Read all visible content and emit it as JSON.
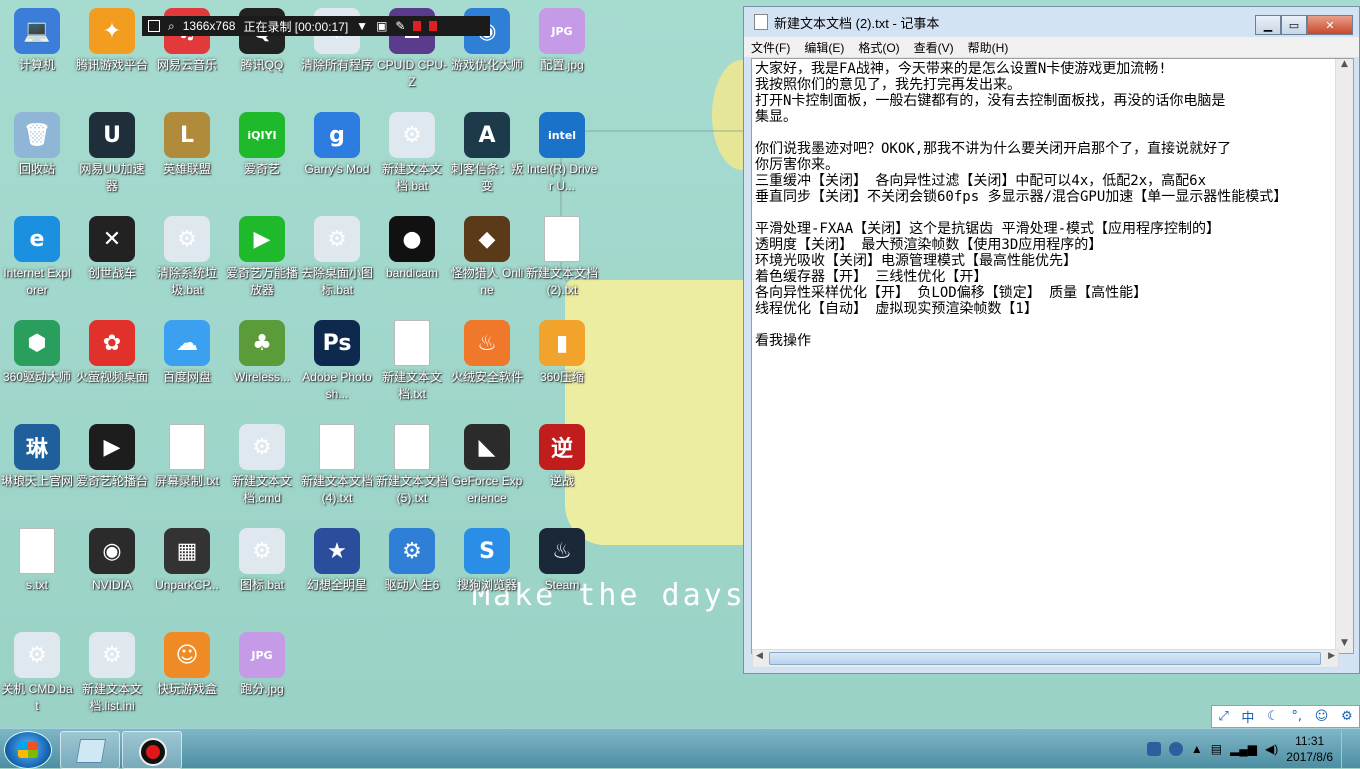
{
  "recorder": {
    "resolution": "1366x768",
    "status": "正在录制 [00:00:17]"
  },
  "notepad": {
    "title": "新建文本文档 (2).txt - 记事本",
    "menu": [
      "文件(F)",
      "编辑(E)",
      "格式(O)",
      "查看(V)",
      "帮助(H)"
    ],
    "content": "大家好，我是FA战神，今天带来的是怎么设置N卡使游戏更加流畅!\n我按照你们的意见了，我先打完再发出来。\n打开N卡控制面板，一般右键都有的，没有去控制面板找，再没的话你电脑是\n集显。\n\n你们说我墨迹对吧？OKOK,那我不讲为什么要关闭开启那个了，直接说就好了\n你厉害你来。\n三重缓冲【关闭】 各向异性过滤【关闭】中配可以4x，低配2x，高配6x\n垂直同步【关闭】不关闭会锁60fps 多显示器/混合GPU加速【单一显示器性能模式】\n\n平滑处理-FXAA【关闭】这个是抗锯齿 平滑处理-模式【应用程序控制的】\n透明度【关闭】 最大预渲染帧数【使用3D应用程序的】\n环境光吸收【关闭】电源管理模式【最高性能优先】\n着色缓存器【开】 三线性优化【开】\n各向异性采样优化【开】 负LOD偏移【锁定】 质量【高性能】\n线程优化【自动】 虚拟现实预渲染帧数【1】\n\n看我操作"
  },
  "wallpaper_text": "Make the days",
  "desktop_icons": [
    {
      "label": "计算机",
      "glyph": "💻",
      "color": "#3b7dd8"
    },
    {
      "label": "腾讯游戏平台",
      "glyph": "✦",
      "color": "#f29d1f"
    },
    {
      "label": "网易云音乐",
      "glyph": "♫",
      "color": "#e23a3a"
    },
    {
      "label": "腾讯QQ",
      "glyph": "Q",
      "color": "#222222"
    },
    {
      "label": "清除所有程序",
      "glyph": "⚙",
      "color": "#dfe7ef"
    },
    {
      "label": "CPUID CPU-Z",
      "glyph": "Z",
      "color": "#5a3b8c"
    },
    {
      "label": "游戏优化大师",
      "glyph": "◉",
      "color": "#2f7fd6"
    },
    {
      "label": "配置.jpg",
      "glyph": "JPG",
      "color": "#c59be8"
    },
    {
      "label": "回收站",
      "glyph": "🗑",
      "color": "#8fb6d6"
    },
    {
      "label": "网易UU加速器",
      "glyph": "U",
      "color": "#1e2f3b"
    },
    {
      "label": "英雄联盟",
      "glyph": "L",
      "color": "#b08b3c"
    },
    {
      "label": "爱奇艺",
      "glyph": "iQIYI",
      "color": "#1fb92c"
    },
    {
      "label": "Garry's Mod",
      "glyph": "g",
      "color": "#2d7de0"
    },
    {
      "label": "新建文本文档.bat",
      "glyph": "⚙",
      "color": "#dfe7ef"
    },
    {
      "label": "刺客信条：叛变",
      "glyph": "A",
      "color": "#1c3a4a"
    },
    {
      "label": "Intel(R) Driver U...",
      "glyph": "intel",
      "color": "#1a73c8"
    },
    {
      "label": "Internet Explorer",
      "glyph": "e",
      "color": "#1b8fe0"
    },
    {
      "label": "创世战车",
      "glyph": "✕",
      "color": "#222222"
    },
    {
      "label": "清除系统垃圾.bat",
      "glyph": "⚙",
      "color": "#dfe7ef"
    },
    {
      "label": "爱奇艺万能播放器",
      "glyph": "▶",
      "color": "#1fb92c"
    },
    {
      "label": "去除桌面小图标.bat",
      "glyph": "⚙",
      "color": "#dfe7ef"
    },
    {
      "label": "bandicam",
      "glyph": "●",
      "color": "#111111"
    },
    {
      "label": "怪物猎人 Online",
      "glyph": "◆",
      "color": "#5a3a18"
    },
    {
      "label": "新建文本文档 (2).txt",
      "glyph": "",
      "color": "#ffffff"
    },
    {
      "label": "360驱动大师",
      "glyph": "⬢",
      "color": "#2a9e5c"
    },
    {
      "label": "火萤视频桌面",
      "glyph": "✿",
      "color": "#e2302b"
    },
    {
      "label": "百度网盘",
      "glyph": "☁",
      "color": "#3aa0ef"
    },
    {
      "label": "Wireless...",
      "glyph": "♣",
      "color": "#5c9b3a"
    },
    {
      "label": "Adobe Photosh...",
      "glyph": "Ps",
      "color": "#0d2a4e"
    },
    {
      "label": "新建文本文档.txt",
      "glyph": "",
      "color": "#ffffff"
    },
    {
      "label": "火绒安全软件",
      "glyph": "♨",
      "color": "#f0782a"
    },
    {
      "label": "360压缩",
      "glyph": "▮",
      "color": "#f2a32c"
    },
    {
      "label": "琳琅天上官网",
      "glyph": "琳",
      "color": "#1f5f9c"
    },
    {
      "label": "爱奇艺轮播台",
      "glyph": "▶",
      "color": "#1d1d1d"
    },
    {
      "label": "屏幕录制.txt",
      "glyph": "",
      "color": "#ffffff"
    },
    {
      "label": "新建文本文档.cmd",
      "glyph": "⚙",
      "color": "#dfe7ef"
    },
    {
      "label": "新建文本文档 (4).txt",
      "glyph": "",
      "color": "#ffffff"
    },
    {
      "label": "新建文本文档 (5).txt",
      "glyph": "",
      "color": "#ffffff"
    },
    {
      "label": "GeForce Experience",
      "glyph": "◣",
      "color": "#2b2b2b"
    },
    {
      "label": "逆战",
      "glyph": "逆",
      "color": "#c21d1d"
    },
    {
      "label": "s.txt",
      "glyph": "",
      "color": "#ffffff"
    },
    {
      "label": "NVIDIA",
      "glyph": "◉",
      "color": "#2b2b2b"
    },
    {
      "label": "UnparkCP...",
      "glyph": "▦",
      "color": "#333333"
    },
    {
      "label": "图标.bat",
      "glyph": "⚙",
      "color": "#dfe7ef"
    },
    {
      "label": "幻想全明星",
      "glyph": "★",
      "color": "#2b4e9c"
    },
    {
      "label": "驱动人生6",
      "glyph": "⚙",
      "color": "#2f7fd6"
    },
    {
      "label": "搜狗浏览器",
      "glyph": "S",
      "color": "#2a8ee6"
    },
    {
      "label": "Steam",
      "glyph": "♨",
      "color": "#1b2838"
    },
    {
      "label": "关机 CMD.bat",
      "glyph": "⚙",
      "color": "#dfe7ef"
    },
    {
      "label": "新建文本文档.list.ini",
      "glyph": "⚙",
      "color": "#dfe7ef"
    },
    {
      "label": "快玩游戏盒",
      "glyph": "☺",
      "color": "#f08a24"
    },
    {
      "label": "跑分.jpg",
      "glyph": "JPG",
      "color": "#c59be8"
    }
  ],
  "ime": {
    "lang": "中"
  },
  "clock": {
    "time": "11:31",
    "date": "2017/8/6"
  }
}
